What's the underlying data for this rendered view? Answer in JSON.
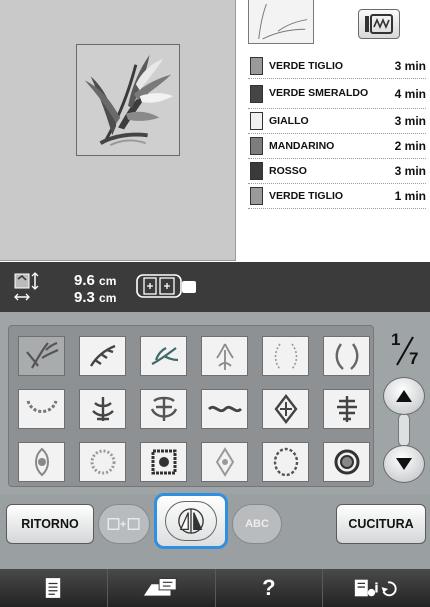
{
  "colors": {
    "accent": "#2f8fe0",
    "dark_bar": "#3b3b3b",
    "grid_bg": "#9fa4a6"
  },
  "icons": {
    "machine": "machine-embroidery-icon",
    "size": "size-arrows-icon",
    "hoop": "hoop-icon",
    "mirror": "mirror-flip-icon",
    "combine": "combine-icon",
    "list": "document-icon",
    "memory": "memory-device-icon",
    "settings": "settings-icon"
  },
  "threads": [
    {
      "name": "VERDE TIGLIO",
      "time": "3 min",
      "color": "#9a9a9a"
    },
    {
      "name": "VERDE SMERALDO",
      "time": "4 min",
      "color": "#454545"
    },
    {
      "name": "GIALLO",
      "time": "3 min",
      "color": "#f0f0f0"
    },
    {
      "name": "MANDARINO",
      "time": "2 min",
      "color": "#7d7d7d"
    },
    {
      "name": "ROSSO",
      "time": "3 min",
      "color": "#3a3a3a"
    },
    {
      "name": "VERDE TIGLIO",
      "time": "1 min",
      "color": "#9a9a9a"
    }
  ],
  "size": {
    "height": "9.6",
    "width": "9.3",
    "unit": "cm"
  },
  "pagination": {
    "current": "1",
    "total": "7"
  },
  "patterns": [
    {
      "name": "lily-pattern",
      "selected": true
    },
    {
      "name": "flower-spray-pattern",
      "selected": false
    },
    {
      "name": "leaf-branch-pattern",
      "selected": false
    },
    {
      "name": "flower-bouquet-pattern",
      "selected": false
    },
    {
      "name": "wreath-open-pattern",
      "selected": false
    },
    {
      "name": "laurel-wreath-pattern",
      "selected": false
    },
    {
      "name": "floral-garland-pattern",
      "selected": false
    },
    {
      "name": "ornament-fleur-pattern",
      "selected": false
    },
    {
      "name": "damask-motif-pattern",
      "selected": false
    },
    {
      "name": "scroll-border-pattern",
      "selected": false
    },
    {
      "name": "diamond-ornament-pattern",
      "selected": false
    },
    {
      "name": "tassel-ornament-pattern",
      "selected": false
    },
    {
      "name": "fleur-tall-pattern",
      "selected": false
    },
    {
      "name": "round-medallion-pattern",
      "selected": false
    },
    {
      "name": "square-damask-pattern",
      "selected": false
    },
    {
      "name": "lozenge-ornament-pattern",
      "selected": false
    },
    {
      "name": "oval-wreath-pattern",
      "selected": false
    },
    {
      "name": "ring-circle-pattern",
      "selected": false
    }
  ],
  "buttons": {
    "back": "RITORNO",
    "sew": "CUCITURA",
    "abc": "ABC"
  },
  "nav": {
    "help": "?"
  }
}
